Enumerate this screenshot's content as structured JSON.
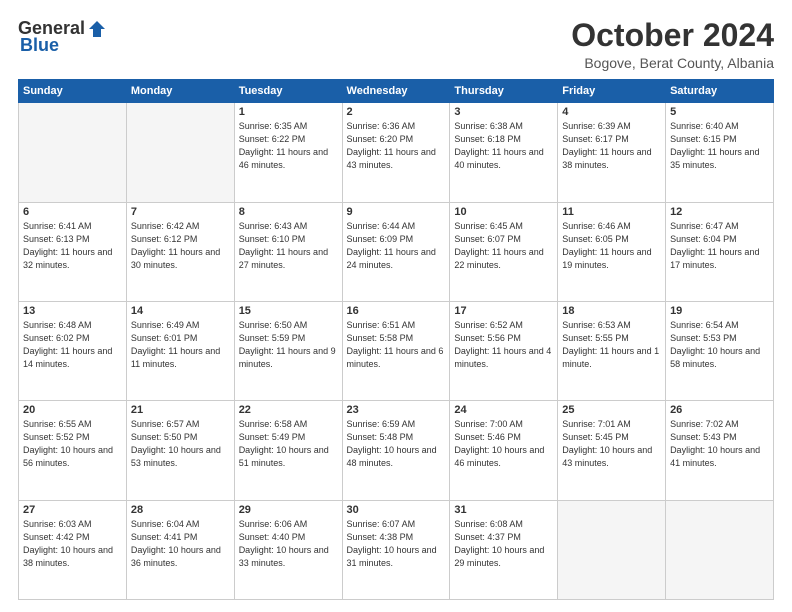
{
  "header": {
    "logo": {
      "general": "General",
      "blue": "Blue",
      "tagline": ""
    },
    "title": "October 2024",
    "subtitle": "Bogove, Berat County, Albania"
  },
  "calendar": {
    "days_of_week": [
      "Sunday",
      "Monday",
      "Tuesday",
      "Wednesday",
      "Thursday",
      "Friday",
      "Saturday"
    ],
    "weeks": [
      [
        {
          "day": "",
          "empty": true
        },
        {
          "day": "",
          "empty": true
        },
        {
          "day": "1",
          "sunrise": "6:35 AM",
          "sunset": "6:22 PM",
          "daylight": "11 hours and 46 minutes."
        },
        {
          "day": "2",
          "sunrise": "6:36 AM",
          "sunset": "6:20 PM",
          "daylight": "11 hours and 43 minutes."
        },
        {
          "day": "3",
          "sunrise": "6:38 AM",
          "sunset": "6:18 PM",
          "daylight": "11 hours and 40 minutes."
        },
        {
          "day": "4",
          "sunrise": "6:39 AM",
          "sunset": "6:17 PM",
          "daylight": "11 hours and 38 minutes."
        },
        {
          "day": "5",
          "sunrise": "6:40 AM",
          "sunset": "6:15 PM",
          "daylight": "11 hours and 35 minutes."
        }
      ],
      [
        {
          "day": "6",
          "sunrise": "6:41 AM",
          "sunset": "6:13 PM",
          "daylight": "11 hours and 32 minutes."
        },
        {
          "day": "7",
          "sunrise": "6:42 AM",
          "sunset": "6:12 PM",
          "daylight": "11 hours and 30 minutes."
        },
        {
          "day": "8",
          "sunrise": "6:43 AM",
          "sunset": "6:10 PM",
          "daylight": "11 hours and 27 minutes."
        },
        {
          "day": "9",
          "sunrise": "6:44 AM",
          "sunset": "6:09 PM",
          "daylight": "11 hours and 24 minutes."
        },
        {
          "day": "10",
          "sunrise": "6:45 AM",
          "sunset": "6:07 PM",
          "daylight": "11 hours and 22 minutes."
        },
        {
          "day": "11",
          "sunrise": "6:46 AM",
          "sunset": "6:05 PM",
          "daylight": "11 hours and 19 minutes."
        },
        {
          "day": "12",
          "sunrise": "6:47 AM",
          "sunset": "6:04 PM",
          "daylight": "11 hours and 17 minutes."
        }
      ],
      [
        {
          "day": "13",
          "sunrise": "6:48 AM",
          "sunset": "6:02 PM",
          "daylight": "11 hours and 14 minutes."
        },
        {
          "day": "14",
          "sunrise": "6:49 AM",
          "sunset": "6:01 PM",
          "daylight": "11 hours and 11 minutes."
        },
        {
          "day": "15",
          "sunrise": "6:50 AM",
          "sunset": "5:59 PM",
          "daylight": "11 hours and 9 minutes."
        },
        {
          "day": "16",
          "sunrise": "6:51 AM",
          "sunset": "5:58 PM",
          "daylight": "11 hours and 6 minutes."
        },
        {
          "day": "17",
          "sunrise": "6:52 AM",
          "sunset": "5:56 PM",
          "daylight": "11 hours and 4 minutes."
        },
        {
          "day": "18",
          "sunrise": "6:53 AM",
          "sunset": "5:55 PM",
          "daylight": "11 hours and 1 minute."
        },
        {
          "day": "19",
          "sunrise": "6:54 AM",
          "sunset": "5:53 PM",
          "daylight": "10 hours and 58 minutes."
        }
      ],
      [
        {
          "day": "20",
          "sunrise": "6:55 AM",
          "sunset": "5:52 PM",
          "daylight": "10 hours and 56 minutes."
        },
        {
          "day": "21",
          "sunrise": "6:57 AM",
          "sunset": "5:50 PM",
          "daylight": "10 hours and 53 minutes."
        },
        {
          "day": "22",
          "sunrise": "6:58 AM",
          "sunset": "5:49 PM",
          "daylight": "10 hours and 51 minutes."
        },
        {
          "day": "23",
          "sunrise": "6:59 AM",
          "sunset": "5:48 PM",
          "daylight": "10 hours and 48 minutes."
        },
        {
          "day": "24",
          "sunrise": "7:00 AM",
          "sunset": "5:46 PM",
          "daylight": "10 hours and 46 minutes."
        },
        {
          "day": "25",
          "sunrise": "7:01 AM",
          "sunset": "5:45 PM",
          "daylight": "10 hours and 43 minutes."
        },
        {
          "day": "26",
          "sunrise": "7:02 AM",
          "sunset": "5:43 PM",
          "daylight": "10 hours and 41 minutes."
        }
      ],
      [
        {
          "day": "27",
          "sunrise": "6:03 AM",
          "sunset": "4:42 PM",
          "daylight": "10 hours and 38 minutes."
        },
        {
          "day": "28",
          "sunrise": "6:04 AM",
          "sunset": "4:41 PM",
          "daylight": "10 hours and 36 minutes."
        },
        {
          "day": "29",
          "sunrise": "6:06 AM",
          "sunset": "4:40 PM",
          "daylight": "10 hours and 33 minutes."
        },
        {
          "day": "30",
          "sunrise": "6:07 AM",
          "sunset": "4:38 PM",
          "daylight": "10 hours and 31 minutes."
        },
        {
          "day": "31",
          "sunrise": "6:08 AM",
          "sunset": "4:37 PM",
          "daylight": "10 hours and 29 minutes."
        },
        {
          "day": "",
          "empty": true
        },
        {
          "day": "",
          "empty": true
        }
      ]
    ]
  }
}
